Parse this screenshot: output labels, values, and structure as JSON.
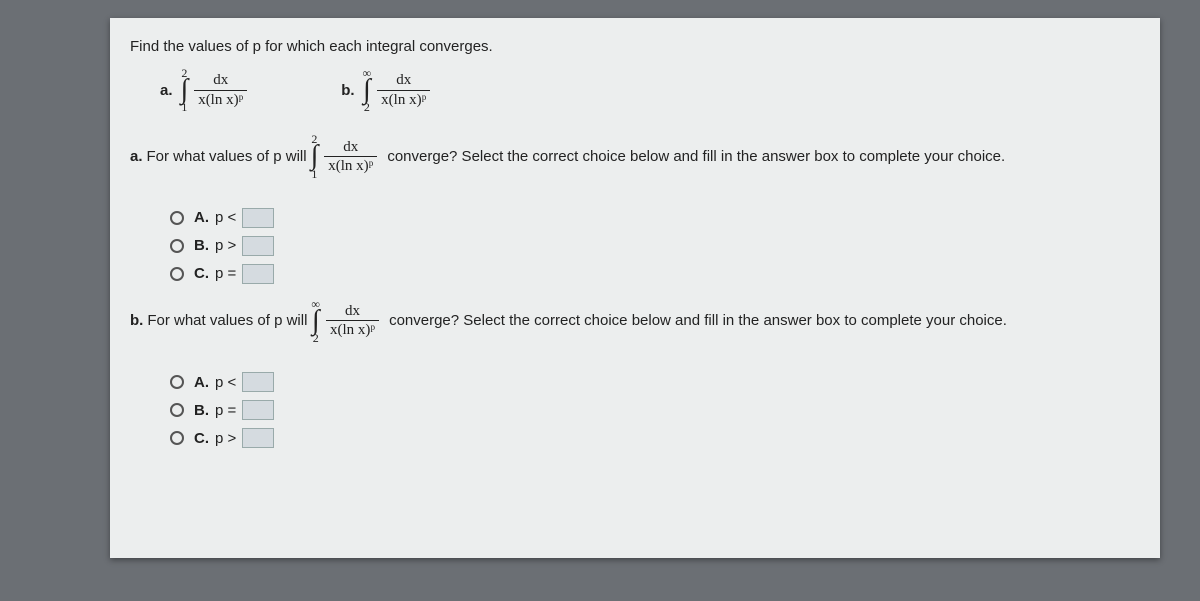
{
  "instruction": "Find the values of p for which each integral converges.",
  "integrals": {
    "a": {
      "label": "a.",
      "lower": "1",
      "upper": "2",
      "num": "dx",
      "den": "x(ln x)ᵖ"
    },
    "b": {
      "label": "b.",
      "lower": "2",
      "upper": "∞",
      "num": "dx",
      "den": "x(ln x)ᵖ"
    }
  },
  "part_a": {
    "label": "a.",
    "before": "For what values of p will",
    "int_lower": "1",
    "int_upper": "2",
    "num": "dx",
    "den": "x(ln x)ᵖ",
    "after": "converge? Select the correct choice below and fill in the answer box to complete your choice.",
    "options": [
      {
        "letter": "A.",
        "text": "p <"
      },
      {
        "letter": "B.",
        "text": "p >"
      },
      {
        "letter": "C.",
        "text": "p ="
      }
    ]
  },
  "part_b": {
    "label": "b.",
    "before": "For what values of p will",
    "int_lower": "2",
    "int_upper": "∞",
    "num": "dx",
    "den": "x(ln x)ᵖ",
    "after": "converge? Select the correct choice below and fill in the answer box to complete your choice.",
    "options": [
      {
        "letter": "A.",
        "text": "p <"
      },
      {
        "letter": "B.",
        "text": "p ="
      },
      {
        "letter": "C.",
        "text": "p >"
      }
    ]
  }
}
